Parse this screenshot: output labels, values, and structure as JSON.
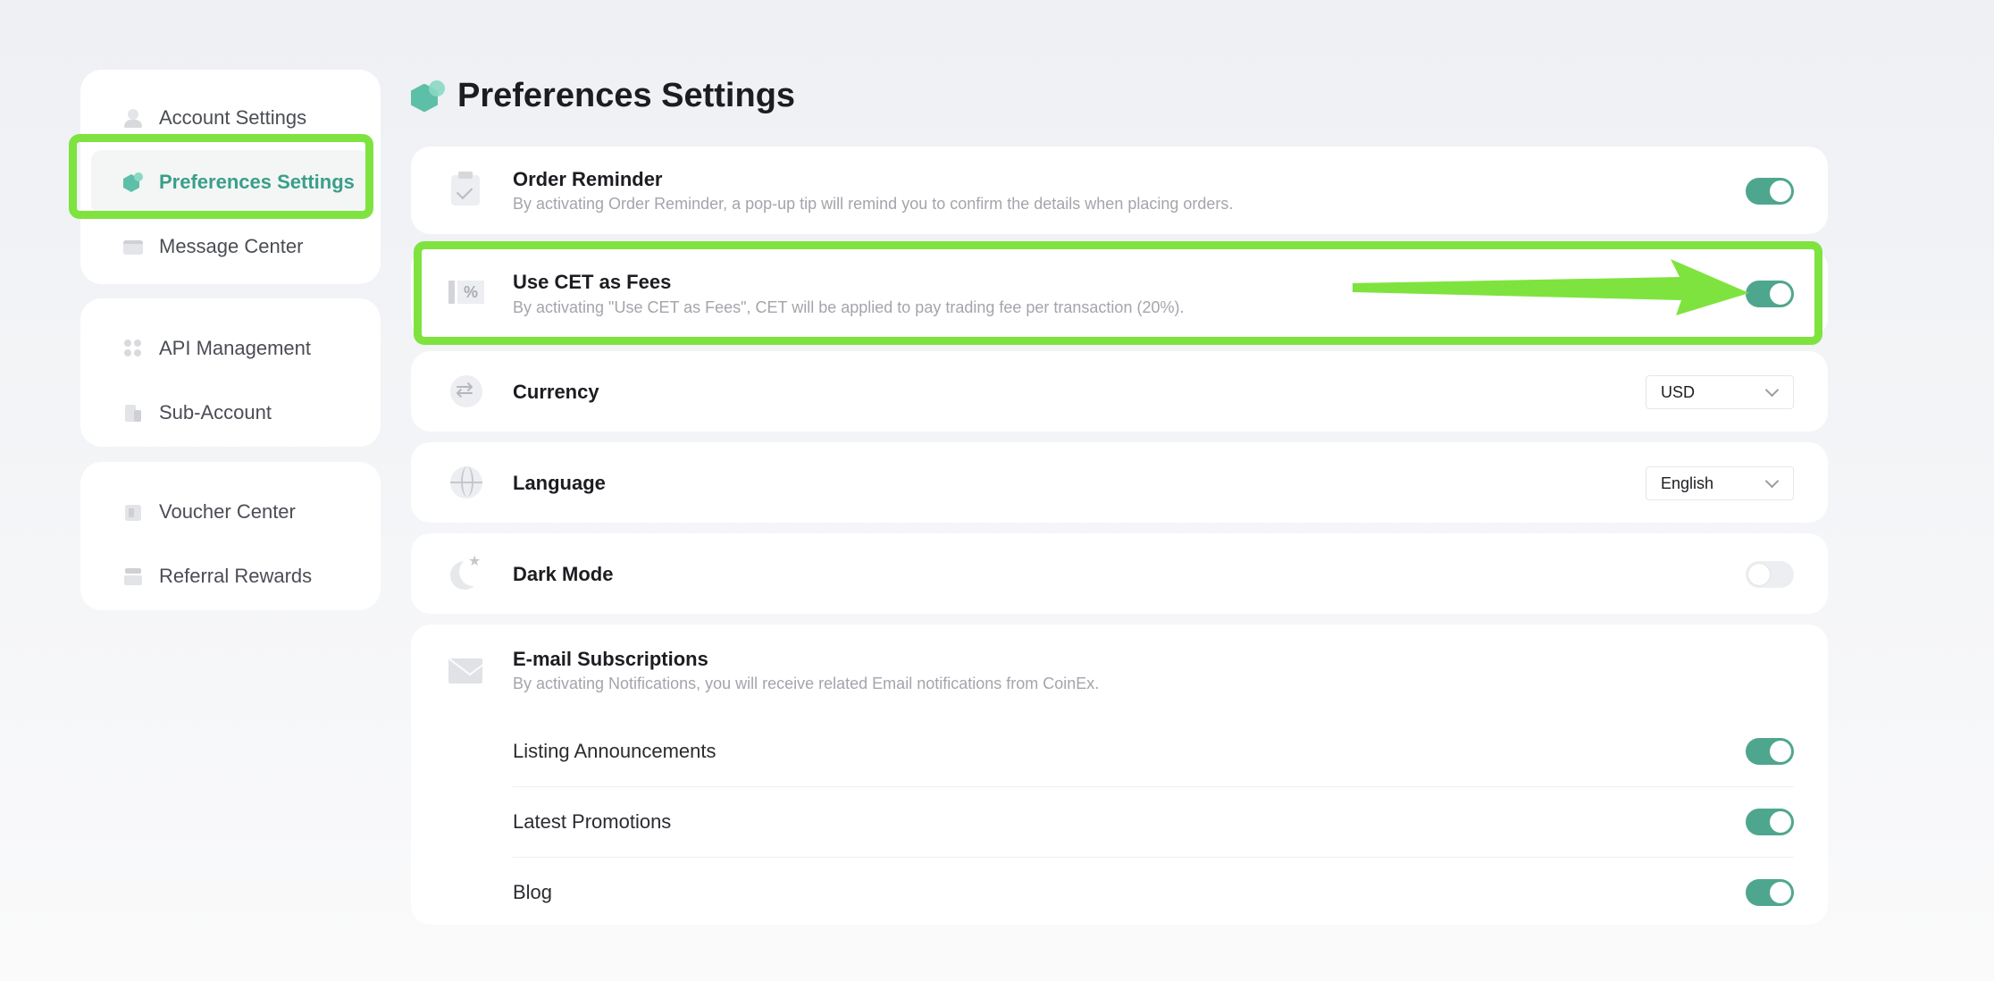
{
  "sidebar": {
    "groups": [
      [
        {
          "label": "Account Settings",
          "icon": "person-icon"
        },
        {
          "label": "Preferences Settings",
          "icon": "preferences-icon",
          "active": true
        },
        {
          "label": "Message Center",
          "icon": "message-icon"
        }
      ],
      [
        {
          "label": "API Management",
          "icon": "api-icon"
        },
        {
          "label": "Sub-Account",
          "icon": "sub-account-icon"
        }
      ],
      [
        {
          "label": "Voucher Center",
          "icon": "voucher-icon"
        },
        {
          "label": "Referral Rewards",
          "icon": "referral-icon"
        }
      ]
    ]
  },
  "header": {
    "title": "Preferences Settings"
  },
  "settings": {
    "order_reminder": {
      "title": "Order Reminder",
      "desc": "By activating Order Reminder, a pop-up tip will remind you to confirm the details when placing orders.",
      "enabled": true
    },
    "cet_fees": {
      "title": "Use CET as Fees",
      "desc": "By activating \"Use CET as Fees\", CET will be applied to pay trading fee per transaction (20%).",
      "enabled": true
    },
    "currency": {
      "title": "Currency",
      "value": "USD"
    },
    "language": {
      "title": "Language",
      "value": "English"
    },
    "dark_mode": {
      "title": "Dark Mode",
      "enabled": false
    },
    "email": {
      "title": "E-mail Subscriptions",
      "desc": "By activating Notifications, you will receive related Email notifications from CoinEx.",
      "items": [
        {
          "label": "Listing Announcements",
          "enabled": true
        },
        {
          "label": "Latest Promotions",
          "enabled": true
        },
        {
          "label": "Blog",
          "enabled": true
        }
      ]
    }
  },
  "colors": {
    "accent": "#4fa68e",
    "highlight": "#7fe33f",
    "toggle_off": "#eceef1"
  }
}
